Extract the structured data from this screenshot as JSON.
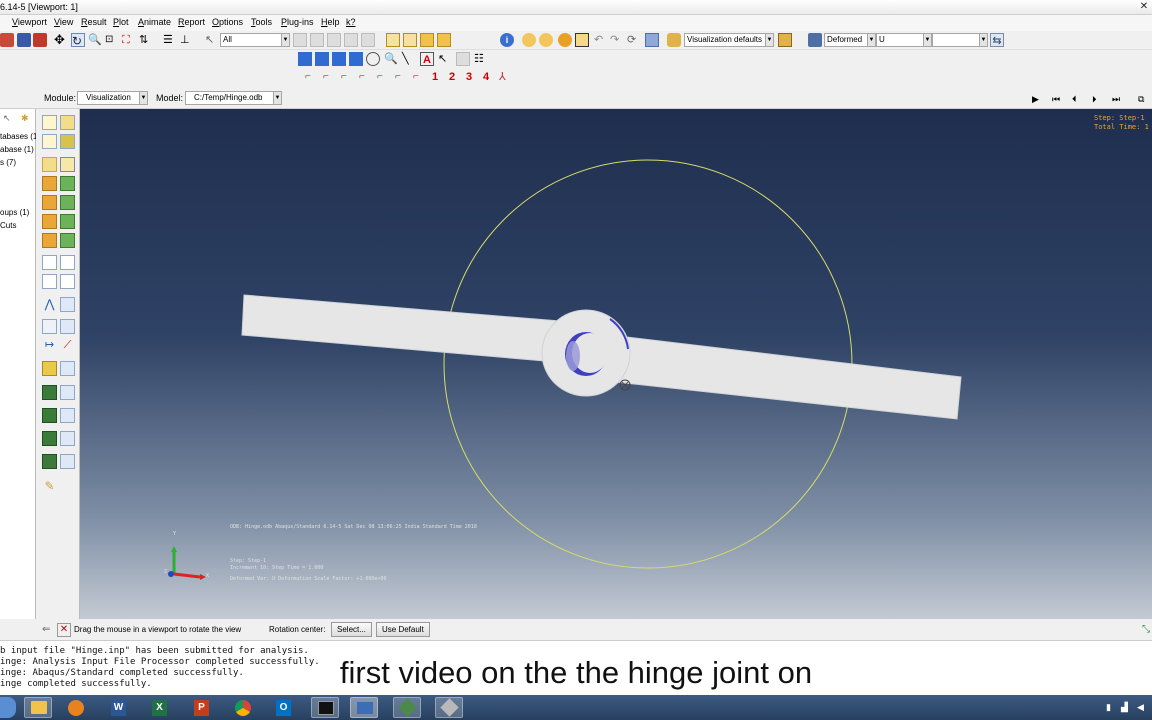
{
  "window": {
    "title": "6.14-5 [Viewport: 1]",
    "close_glyph": "✕"
  },
  "menu": [
    "Viewport",
    "View",
    "Result",
    "Plot",
    "Animate",
    "Report",
    "Options",
    "Tools",
    "Plug-ins",
    "Help",
    "k?"
  ],
  "toolbar": {
    "selection_filter": "All",
    "visualization_defaults": "Visualization defaults",
    "deform_state": "Deformed",
    "variable": "U",
    "variable_component": ""
  },
  "view_numbers": [
    "1",
    "2",
    "3",
    "4"
  ],
  "module_bar": {
    "module_label": "Module:",
    "module_value": "Visualization",
    "model_label": "Model:",
    "model_value": "C:/Temp/Hinge.odb"
  },
  "tree_items": [
    "tabases (1",
    "abase (1)",
    "s (7)",
    "oups (1)",
    "Cuts"
  ],
  "viewport": {
    "step_info": [
      "Step: Step-1",
      "Total Time: 1"
    ],
    "odb_line": "ODB: Hinge.odb    Abaqus/Standard 6.14-5    Sat Dec 08 13:06:25 India Standard Time 2018",
    "state_lines": [
      "Step: Step-1",
      "Increment    10: Step Time =     1.000",
      "Deformed Var: U   Deformation Scale Factor: +1.000e+00"
    ],
    "triad": {
      "y": "Y",
      "x": "X",
      "z": "Z"
    }
  },
  "prompt": {
    "text": "Drag the mouse in a viewport to rotate the view",
    "rotation_center_label": "Rotation center:",
    "select_button": "Select...",
    "default_button": "Use Default"
  },
  "messages": [
    "b input file \"Hinge.inp\" has been submitted for analysis.",
    "inge: Analysis Input File Processor completed successfully.",
    "inge: Abaqus/Standard completed successfully.",
    "inge completed successfully."
  ],
  "subtitle": "first video on the the hinge joint on",
  "taskbar_apps": [
    "start",
    "file-explorer",
    "media-player",
    "word",
    "excel",
    "powerpoint",
    "chrome",
    "outlook",
    "cmd",
    "abaqus-cae",
    "abaqus-viewer",
    "abaqus-job"
  ],
  "colors": {
    "viewport_top": "#1f2e4e",
    "viewport_bottom": "#c3cad3",
    "model_fill": "#e6e6e6",
    "rotation_circle": "#d7dc6a",
    "hinge_edge": "#3e3fc2",
    "taskbar": "#2f4a6d"
  }
}
